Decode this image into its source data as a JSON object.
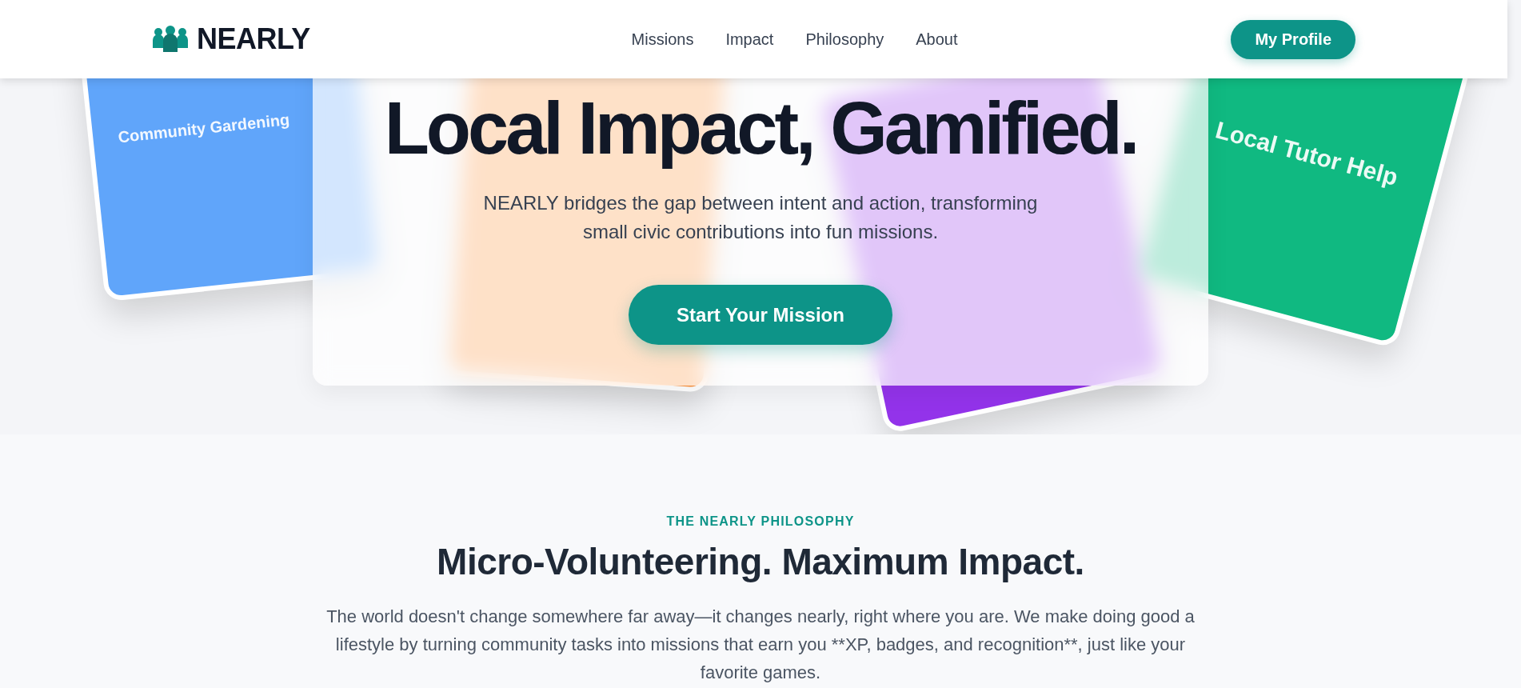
{
  "header": {
    "brand": "NEARLY",
    "nav": [
      "Missions",
      "Impact",
      "Philosophy",
      "About"
    ],
    "profile_button": "My Profile"
  },
  "hero": {
    "title_line_2": "Local Impact, Gamified.",
    "subtitle": "NEARLY bridges the gap between intent and action, transforming small civic contributions into fun missions.",
    "cta": "Start Your Mission",
    "cards": [
      {
        "label": "Community Gardening",
        "color": "#60a5fa"
      },
      {
        "color": "#fb923c"
      },
      {
        "color": "#9333ea"
      },
      {
        "label": "Local Tutor Help",
        "color": "#10b981"
      }
    ]
  },
  "philosophy": {
    "eyebrow": "THE NEARLY PHILOSOPHY",
    "heading": "Micro-Volunteering. Maximum Impact.",
    "text": "The world doesn't change somewhere far away—it changes nearly, right where you are. We make doing good a lifestyle by turning community tasks into missions that earn you **XP, badges, and recognition**, just like your favorite games."
  }
}
